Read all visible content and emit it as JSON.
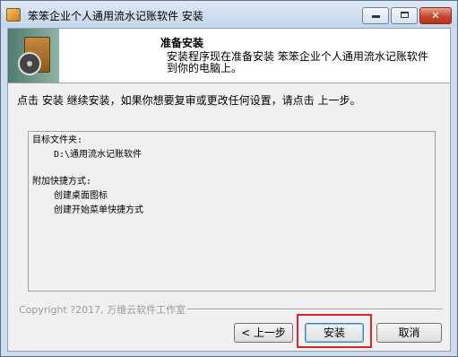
{
  "window": {
    "title": "笨笨企业个人通用流水记账软件  安装",
    "min_icon": "minimize-icon",
    "max_icon": "maximize-icon",
    "close_glyph": "✕"
  },
  "header": {
    "title": "准备安装",
    "subtitle": "安装程序现在准备安装 笨笨企业个人通用流水记账软件 到你的电脑上。",
    "art_icon": "installer-box-disc-icon"
  },
  "instruction": "点击 安装 继续安装，如果你想要复审或更改任何设置，请点击 上一步。",
  "summary": {
    "dest_label": "目标文件夹:",
    "dest_value": "D:\\通用流水记账软件",
    "tasks_label": "附加快捷方式:",
    "tasks": [
      "创建桌面图标",
      "创建开始菜单快捷方式"
    ]
  },
  "footer": {
    "copyright": "Copyright ?2017, 万维云软件工作室"
  },
  "buttons": {
    "back": "< 上一步",
    "install": "安装",
    "cancel": "取消"
  },
  "colors": {
    "highlight": "#d9262b",
    "close_button": "#c8462f",
    "titlebar": "#c4d5ea"
  }
}
